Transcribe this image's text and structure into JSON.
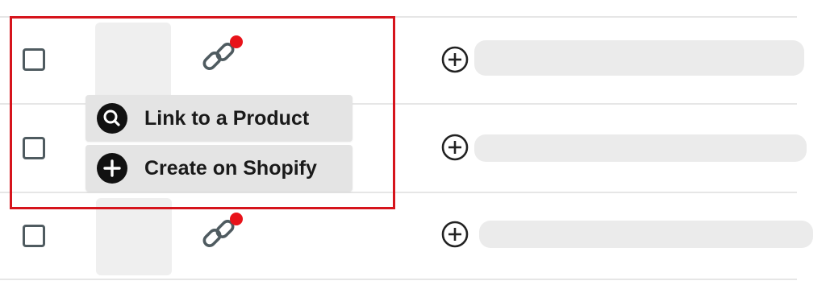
{
  "rows": [
    {
      "checked": false
    },
    {
      "checked": false
    },
    {
      "checked": false
    }
  ],
  "menu": {
    "items": [
      {
        "label": "Link to a Product",
        "icon": "search-icon"
      },
      {
        "label": "Create on Shopify",
        "icon": "plus-circle-icon"
      }
    ]
  },
  "colors": {
    "highlight": "#d6141c",
    "notification_dot": "#e8131a",
    "menu_bg": "#e4e4e4",
    "placeholder": "#ebebeb"
  },
  "icons": {
    "link": "link-icon",
    "add": "add-circle-icon",
    "notification": "notification-dot"
  }
}
